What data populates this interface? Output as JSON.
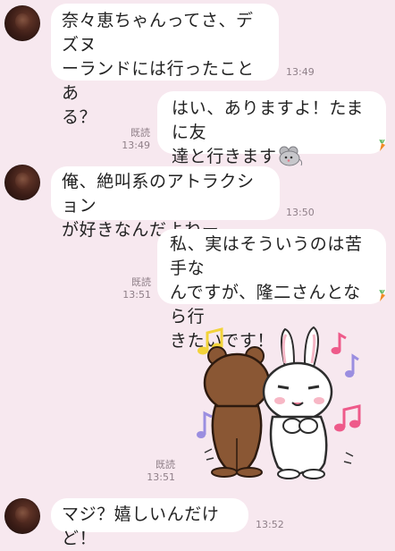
{
  "messages": [
    {
      "side": "left",
      "text": "奈々恵ちゃんってさ、デズヌーランドには行ったことある？",
      "time": "13:49"
    },
    {
      "side": "right",
      "text": "はい、ありますよ！たまに友達と行きます",
      "read": "既読",
      "time": "13:49",
      "icon": "mouse-icon"
    },
    {
      "side": "left",
      "text": "俺、絶叫系のアトラクションが好きなんだよねー",
      "time": "13:50"
    },
    {
      "side": "right",
      "text": "私、実はそういうのは苦手なんですが、隆二さんとなら行きたいです！",
      "read": "既読",
      "time": "13:51"
    },
    {
      "side": "right",
      "type": "sticker",
      "sticker": "bear-and-bunny-sticker",
      "read": "既読",
      "time": "13:51"
    },
    {
      "side": "left",
      "text": "マジ？嬉しいんだけど！",
      "time": "13:52"
    }
  ],
  "texts": {
    "m1_line1": "奈々恵ちゃんってさ、デズヌ",
    "m1_line2": "ーランドには行ったことあ",
    "m1_line3": "る？",
    "m2_line1": "はい、ありますよ！たまに友",
    "m2_line2": "達と行きます",
    "m3_line1": "俺、絶叫系のアトラクション",
    "m3_line2": "が好きなんだよねー",
    "m4_line1": "私、実はそういうのは苦手な",
    "m4_line2": "んですが、隆二さんとなら行",
    "m4_line3": "きたいです！",
    "m6_line1": "マジ？嬉しいんだけど！"
  },
  "colors": {
    "background": "#f7e8ef",
    "bubble": "#ffffff",
    "meta": "#8f7f88"
  }
}
